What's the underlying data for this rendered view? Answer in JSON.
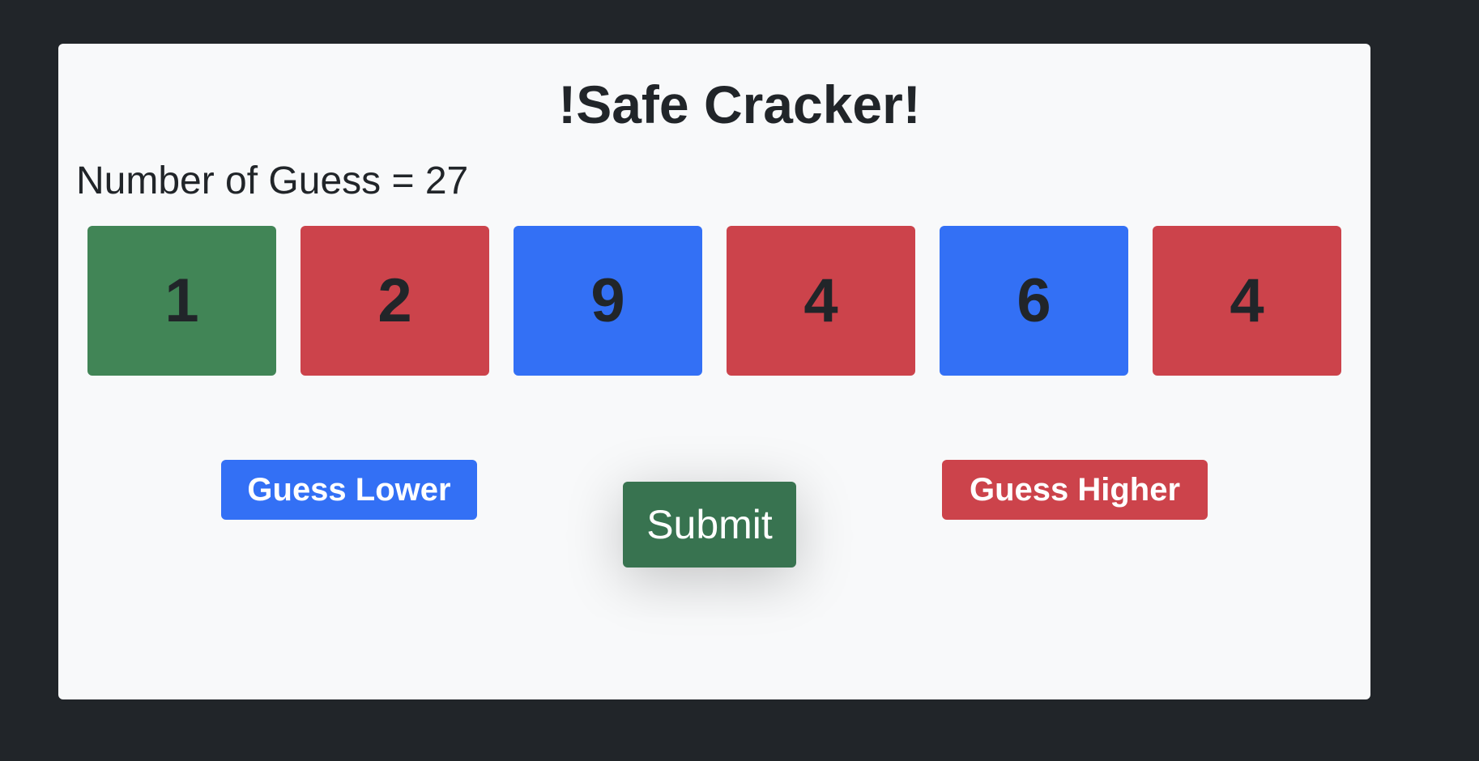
{
  "game": {
    "title": "!Safe Cracker!",
    "guess_count_text": "Number of Guess = 27"
  },
  "digits": [
    {
      "value": "1",
      "color": "#418556"
    },
    {
      "value": "2",
      "color": "#cc434b"
    },
    {
      "value": "9",
      "color": "#3370f5"
    },
    {
      "value": "4",
      "color": "#cc434b"
    },
    {
      "value": "6",
      "color": "#3370f5"
    },
    {
      "value": "4",
      "color": "#cc434b"
    }
  ],
  "controls": {
    "guess_lower_label": "Guess Lower",
    "submit_label": "Submit",
    "guess_higher_label": "Guess Higher"
  },
  "colors": {
    "background": "#212529",
    "card": "#f8f9fa",
    "lower_button": "#3370f5",
    "higher_button": "#cc434b",
    "submit_button": "#387350"
  }
}
